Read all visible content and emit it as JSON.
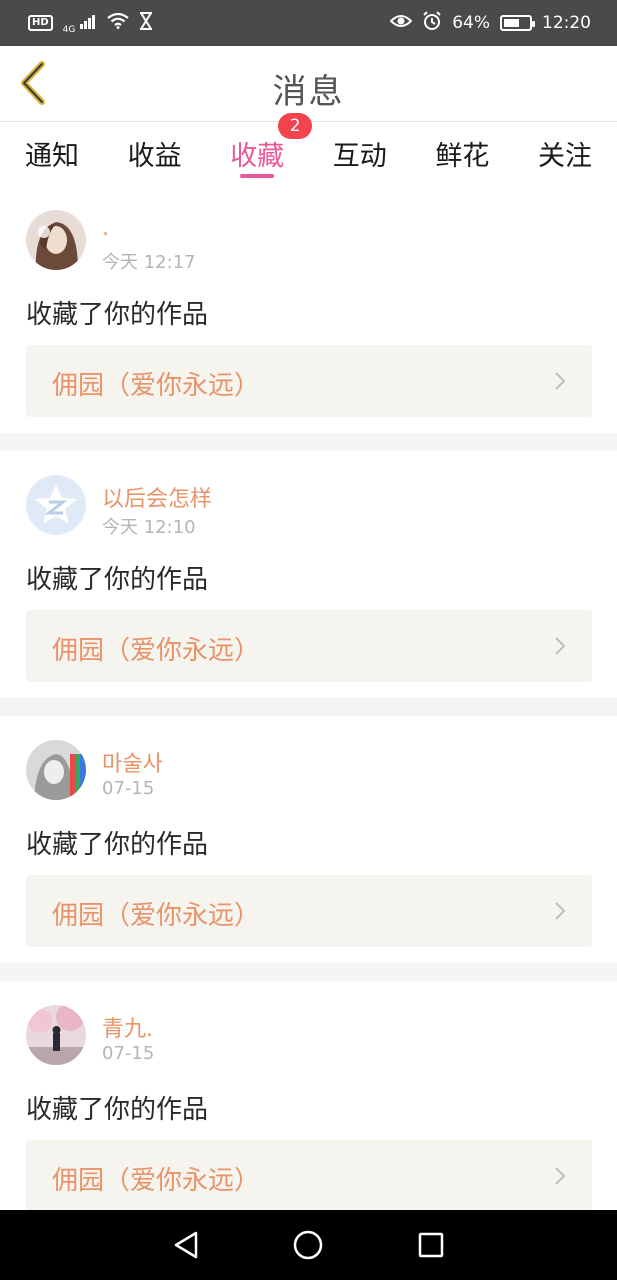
{
  "status_bar": {
    "hd": "HD",
    "network": "4G",
    "battery": "64%",
    "battery_level": 0.64,
    "time": "12:20",
    "icons": [
      "signal-icon",
      "wifi-icon",
      "hourglass-icon",
      "eye-icon",
      "alarm-icon",
      "battery-icon"
    ]
  },
  "header": {
    "title": "消息",
    "back_icon": "chevron-left-icon"
  },
  "tabs": [
    {
      "label": "通知",
      "active": false
    },
    {
      "label": "收益",
      "active": false
    },
    {
      "label": "收藏",
      "active": true,
      "badge": "2"
    },
    {
      "label": "互动",
      "active": false
    },
    {
      "label": "鲜花",
      "active": false
    },
    {
      "label": "关注",
      "active": false
    }
  ],
  "colors": {
    "accent": "#e85a9a",
    "username": "#e8946a",
    "badge": "#f2434f",
    "link_bg": "#f5f4ee"
  },
  "feed": [
    {
      "username": ".",
      "time": "今天 12:17",
      "action": "收藏了你的作品",
      "work": "佣园（爱你永远）"
    },
    {
      "username": "以后会怎样",
      "time": "今天 12:10",
      "action": "收藏了你的作品",
      "work": "佣园（爱你永远）"
    },
    {
      "username": "마술사",
      "time": "07-15",
      "action": "收藏了你的作品",
      "work": "佣园（爱你永远）"
    },
    {
      "username": "青九.",
      "time": "07-15",
      "action": "收藏了你的作品",
      "work": "佣园（爱你永远）"
    }
  ],
  "nav": [
    "back-triangle-icon",
    "home-circle-icon",
    "recents-square-icon"
  ]
}
